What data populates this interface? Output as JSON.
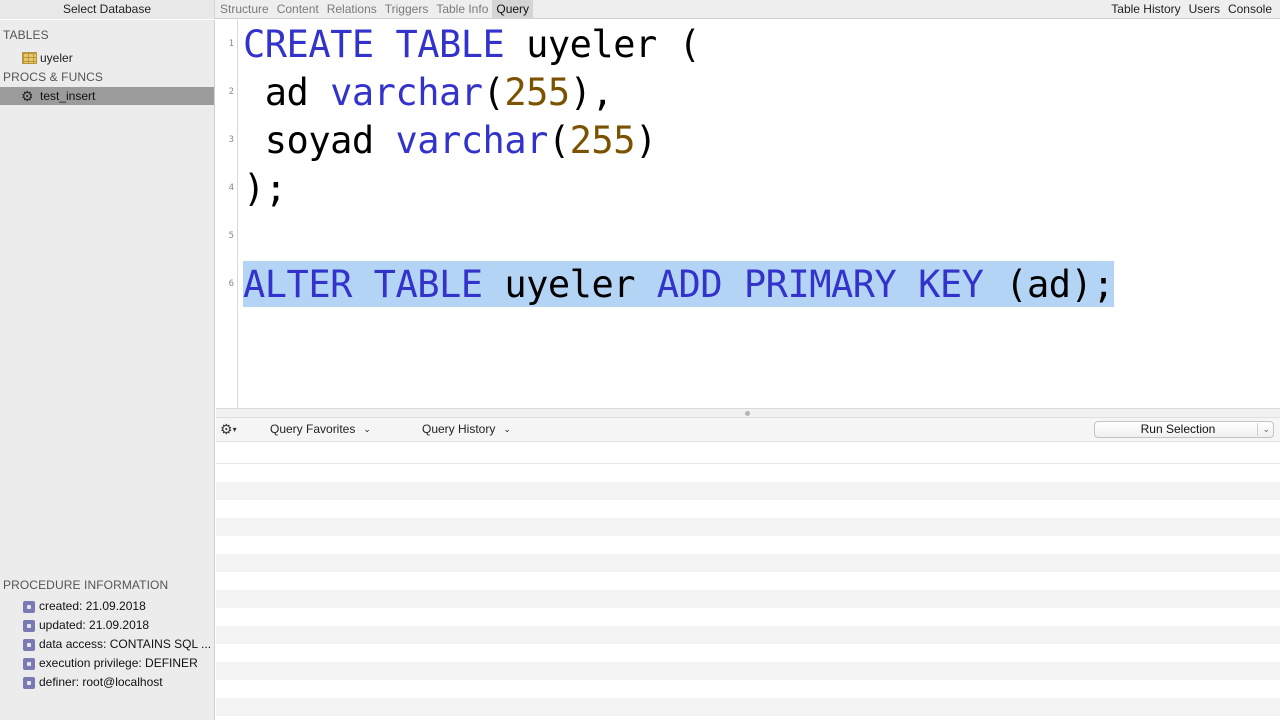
{
  "topbar": {
    "select_database": "Select Database",
    "tabs": [
      {
        "label": "Structure",
        "active": false
      },
      {
        "label": "Content",
        "active": false
      },
      {
        "label": "Relations",
        "active": false
      },
      {
        "label": "Triggers",
        "active": false
      },
      {
        "label": "Table Info",
        "active": false
      },
      {
        "label": "Query",
        "active": true
      }
    ],
    "right": {
      "table_history": "Table History",
      "users": "Users",
      "console": "Console"
    }
  },
  "sidebar": {
    "tables_header": "TABLES",
    "tables": [
      {
        "label": "uyeler",
        "icon": "table-icon"
      }
    ],
    "procs_header": "PROCS & FUNCS",
    "procs": [
      {
        "label": "test_insert",
        "icon": "gear-icon",
        "selected": true
      }
    ],
    "info_header": "PROCEDURE INFORMATION",
    "info": [
      "created: 21.09.2018",
      "updated: 21.09.2018",
      "data access: CONTAINS SQL ...",
      "execution privilege: DEFINER",
      "definer: root@localhost"
    ]
  },
  "editor": {
    "line_numbers": [
      "1",
      "2",
      "3",
      "4",
      "5",
      "6"
    ],
    "lines": [
      [
        {
          "t": "CREATE",
          "c": "kw"
        },
        {
          "t": " "
        },
        {
          "t": "TABLE",
          "c": "kw"
        },
        {
          "t": " uyeler ("
        }
      ],
      [
        {
          "t": " ad "
        },
        {
          "t": "varchar",
          "c": "kw"
        },
        {
          "t": "("
        },
        {
          "t": "255",
          "c": "num"
        },
        {
          "t": "),"
        }
      ],
      [
        {
          "t": " soyad "
        },
        {
          "t": "varchar",
          "c": "kw"
        },
        {
          "t": "("
        },
        {
          "t": "255",
          "c": "num"
        },
        {
          "t": ")"
        }
      ],
      [
        {
          "t": ");"
        }
      ],
      [],
      [
        {
          "t": "ALTER",
          "c": "kw"
        },
        {
          "t": " "
        },
        {
          "t": "TABLE",
          "c": "kw"
        },
        {
          "t": " uyeler "
        },
        {
          "t": "ADD",
          "c": "kw"
        },
        {
          "t": " "
        },
        {
          "t": "PRIMARY",
          "c": "kw"
        },
        {
          "t": " "
        },
        {
          "t": "KEY",
          "c": "kw"
        },
        {
          "t": " (ad);"
        }
      ]
    ],
    "highlighted_line": 6
  },
  "toolbar": {
    "gear_icon": "gear-icon",
    "query_favorites": "Query Favorites",
    "query_history": "Query History",
    "run_button": "Run Selection"
  },
  "colors": {
    "keyword": "#3333cc",
    "number": "#7a5200",
    "selection": "#b3d4f5",
    "sidebar_selected": "#9b9b9b"
  }
}
